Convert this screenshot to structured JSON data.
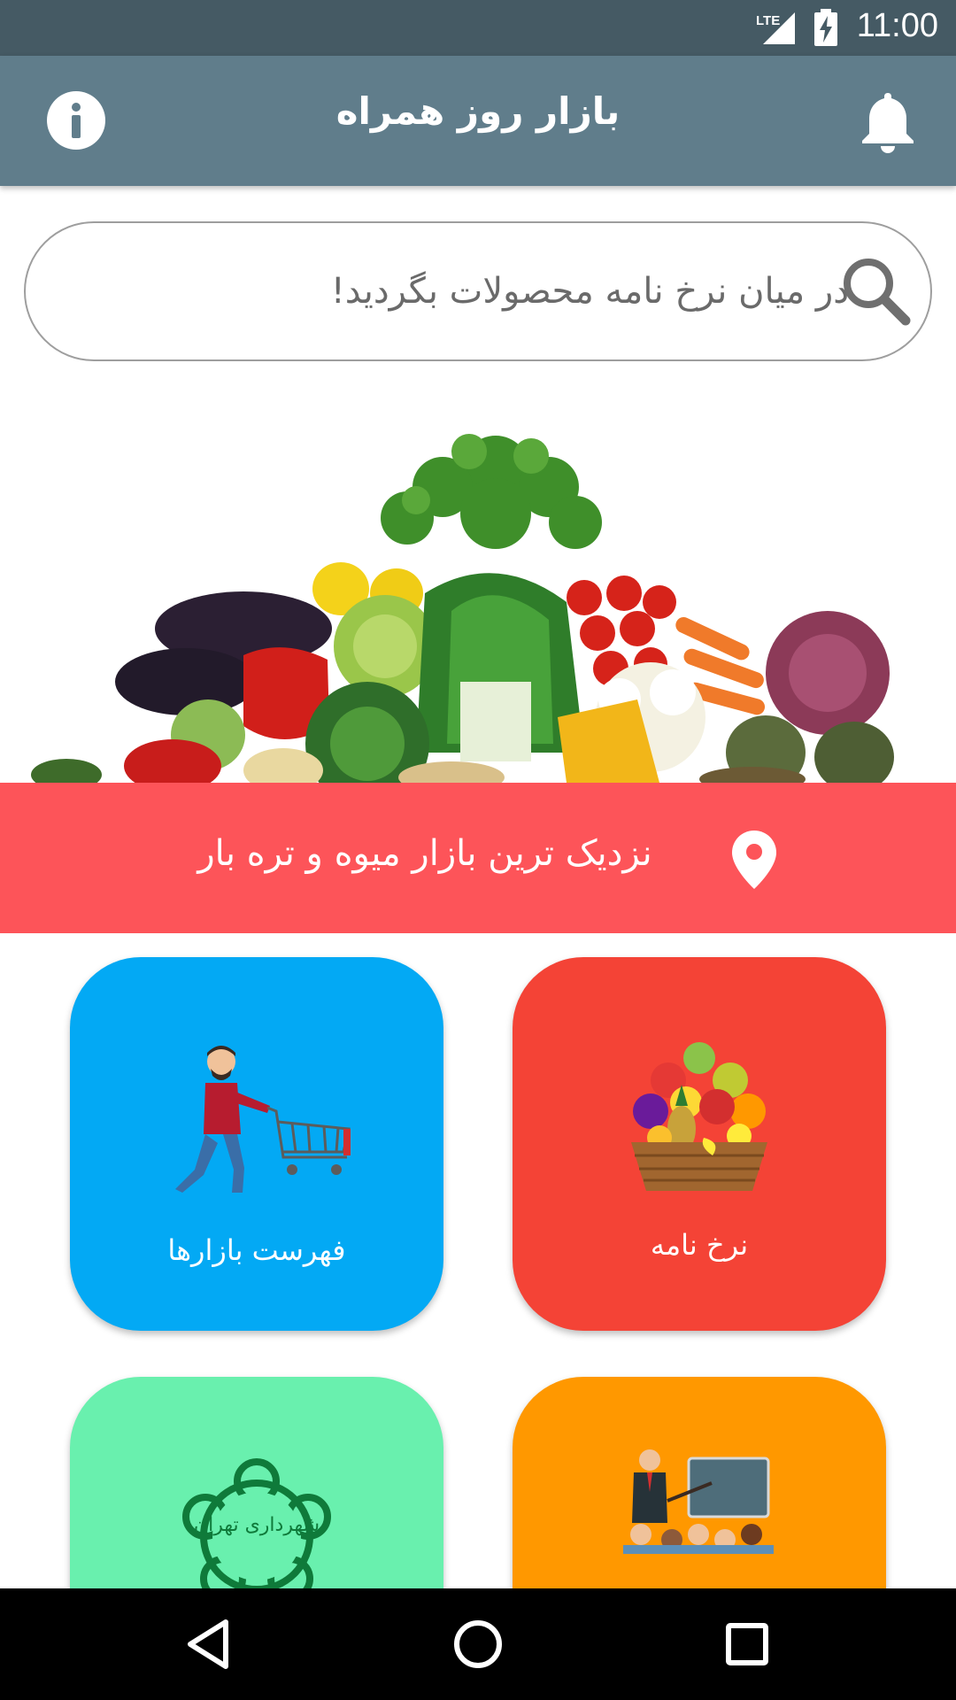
{
  "status_bar": {
    "time": "11:00",
    "network": "LTE"
  },
  "app_bar": {
    "title": "بازار روز همراه",
    "left_icon": "info-icon",
    "right_icon": "bell-icon"
  },
  "search": {
    "placeholder": "در میان نرخ نامه محصولات بگردید!",
    "value": "",
    "icon": "search-icon"
  },
  "nearest": {
    "label": "نزدیک ترین بازار میوه و تره بار",
    "icon": "location-pin-icon"
  },
  "tiles": [
    {
      "id": "markets",
      "label": "فهرست بازارها",
      "color": "#03a9f4",
      "icon": "shopping-cart-man-icon"
    },
    {
      "id": "prices",
      "label": "نرخ نامه",
      "color": "#f44336",
      "icon": "fruit-basket-icon"
    },
    {
      "id": "municipality",
      "label": "",
      "color": "#69f0ae",
      "icon": "tehran-municipality-logo-icon",
      "logo_text": "شهرداری تهران"
    },
    {
      "id": "training",
      "label": "",
      "color": "#ff9800",
      "icon": "teacher-class-icon"
    }
  ],
  "colors": {
    "status_bar": "#455a64",
    "app_bar": "#607d8b",
    "accent_red": "#fd5459"
  }
}
